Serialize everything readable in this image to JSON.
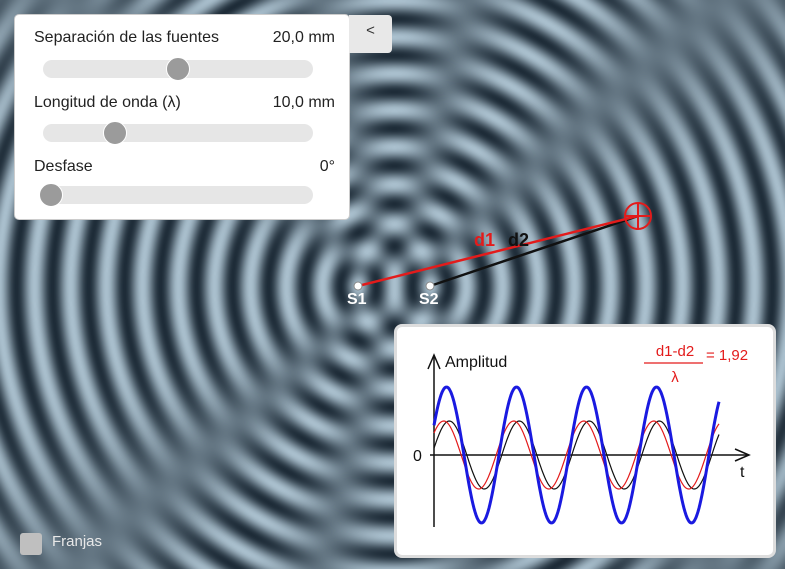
{
  "controls": {
    "collapse_label": "<",
    "separation": {
      "label": "Separación de las fuentes",
      "value": "20,0 mm",
      "fraction": 0.5
    },
    "wavelength": {
      "label": "Longitud de onda (λ)",
      "value": "10,0 mm",
      "fraction": 0.25
    },
    "phase": {
      "label": "Desfase",
      "value": "0°",
      "fraction": 0.0
    }
  },
  "scene": {
    "source1_label": "S1",
    "source2_label": "S2",
    "d1_label": "d1",
    "d2_label": "d2"
  },
  "graph": {
    "ylabel": "Amplitud",
    "xlabel": "t",
    "zero_label": "0",
    "formula_num": "d1-d2",
    "formula_den": "λ",
    "formula_value": "= 1,92"
  },
  "fringes": {
    "label": "Franjas",
    "checked": false
  },
  "colors": {
    "red": "#e31b1b",
    "blue": "#1a1ae0",
    "black": "#111111"
  }
}
